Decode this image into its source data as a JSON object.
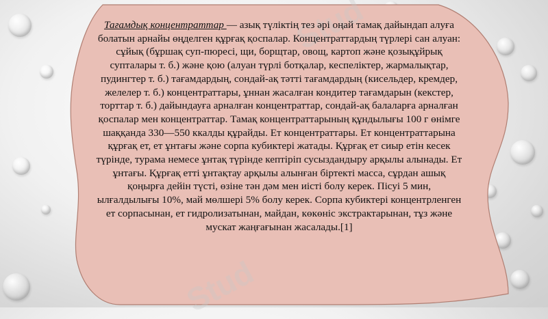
{
  "slide": {
    "title": "Тағамдық концентраттар ",
    "body": "— азық түліктің тез әрі оңай тамақ дайындап алуға болатын арнайы өңделген құрғақ қоспалар. Концентраттардың түрлері сан алуан: сұйық (бұршақ суп-пюресі, щи, борщтар, овощ, картоп және қозықұйрық супталары т. б.) және қою (алуан түрлі ботқалар, кеспеліктер, жармалықтар, пудингтер т. б.) тағамдардың, сондай-ақ тәтті тағамдардың (кисельдер, кремдер, желелер т. б.) концентраттары, ұннан жасалған кондитер тағамдарын (кекстер, торттар т. б.) дайындауға арналған концентраттар, сондай-ақ балаларға арналған қоспалар мен концентраттар.  Тамақ концентраттарының құндылығы 100 г өнімге шаққанда 330—550 ккалды құрайды. Ет концентраттары. Ет концентраттарына құрғақ ет, ет ұнтағы және сорпа кубиктері жатады. Құрғақ ет сиыр етін кесек түрінде, турама немесе ұнтақ түрінде кептіріп сусыздандыру арқылы алынады. Ет ұнтағы. Құрғақ етті ұнтақтау арқылы алынған біртекті масса, сұрдан ашық қоңырға дейін түсті, өзіне тән дәм мен иісті болу керек. Пісуі 5 мин, ылғалдылығы 10%, май мөлшері 5% болу керек. Сорпа кубиктері концентрленген ет сорпасынан, ет гидролизатынан, майдан, көкөніс экстрактарынан, тұз және мускат жаңғағынан жасалады.[1]"
  },
  "colors": {
    "card_fill": "#e9bfb6",
    "card_stroke": "#b07e72",
    "background": "#e6e6e6"
  }
}
